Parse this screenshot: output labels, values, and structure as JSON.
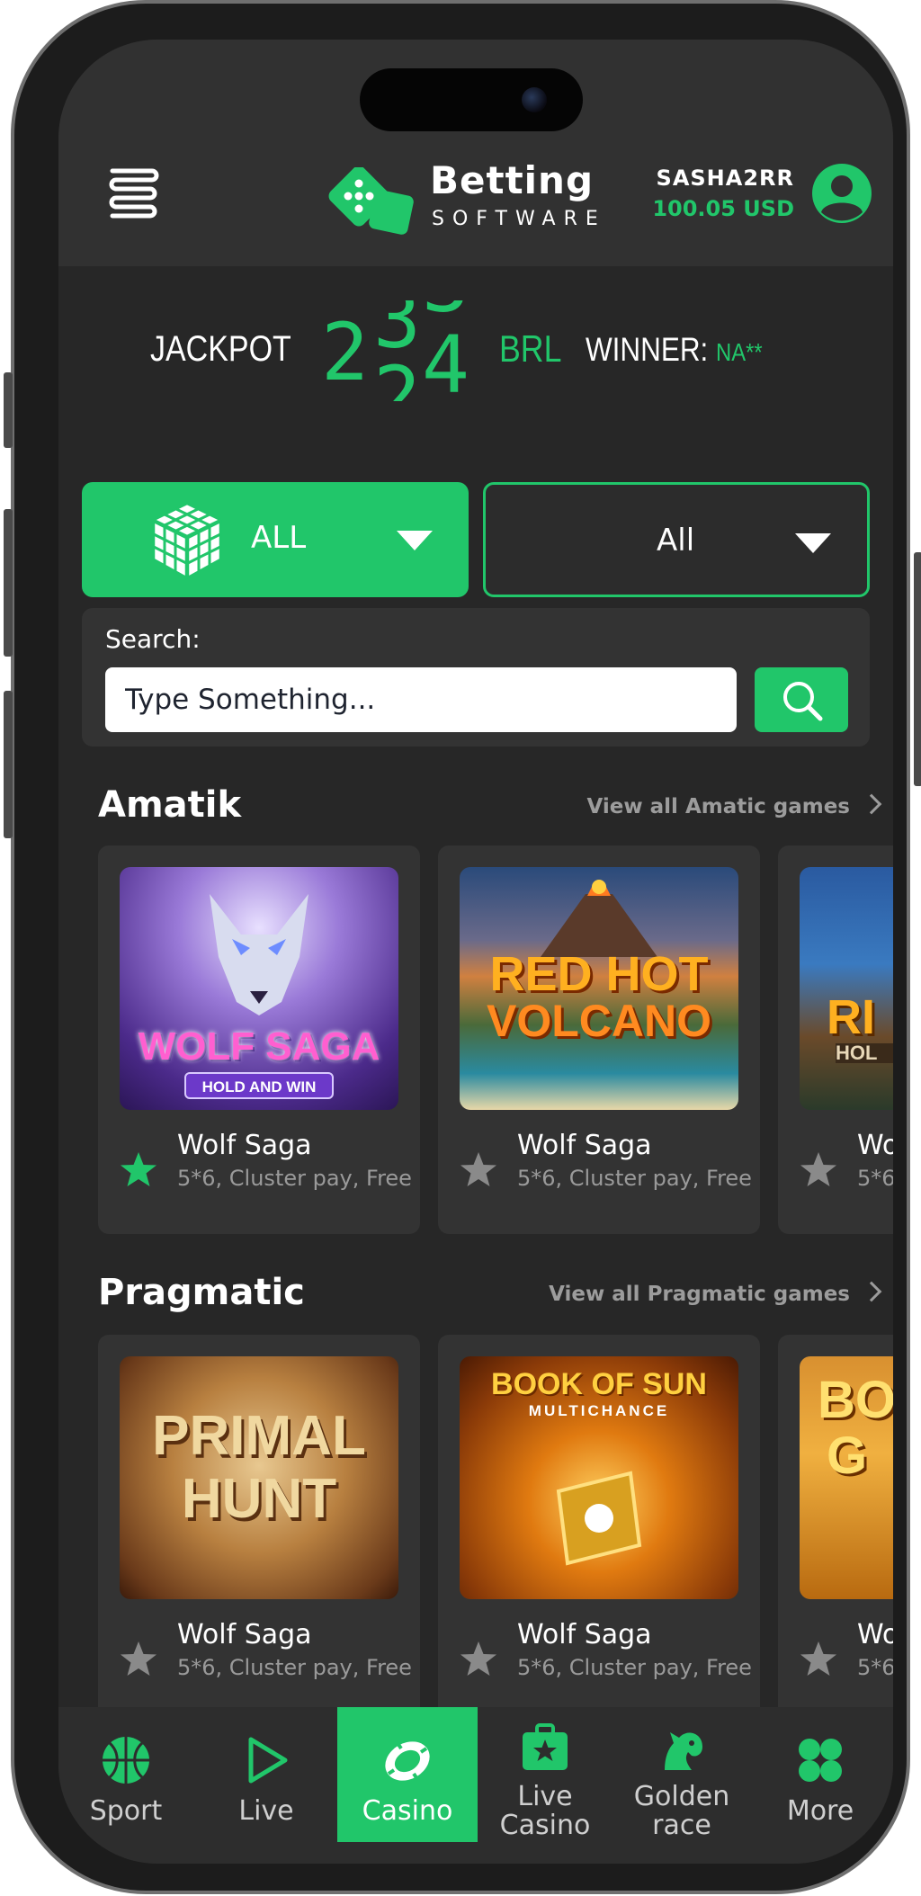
{
  "header": {
    "logo_title": "Betting",
    "logo_subtitle": "SOFTWARE",
    "username": "SASHA2RR",
    "balance": "100.05 USD"
  },
  "jackpot": {
    "label": "JACKPOT",
    "digits_visible": "2 3 4",
    "digit_1": "2",
    "digit_2_top": "3",
    "digit_2_bottom": "2",
    "digit_3_top": "3",
    "digit_3_bottom": "4",
    "currency": "BRL",
    "winner_label": "WINNER:",
    "winner_name": "NA**"
  },
  "filters": {
    "category_label": "ALL",
    "provider_label": "All"
  },
  "search": {
    "label": "Search:",
    "placeholder": "Type Something..."
  },
  "sections": [
    {
      "title": "Amatik",
      "view_all": "View all Amatic games",
      "games": [
        {
          "name": "Wolf Saga",
          "desc": "5*6, Cluster pay, Free",
          "favorite": true,
          "art_line1": "WOLF SAGA",
          "art_line2": "HOLD AND WIN"
        },
        {
          "name": "Wolf Saga",
          "desc": "5*6, Cluster pay, Free",
          "favorite": false,
          "art_line1": "RED HOT",
          "art_line2": "VOLCANO"
        },
        {
          "name": "Wo",
          "desc": "5*6,",
          "favorite": false,
          "art_line1": "RI",
          "art_line2": "HOL"
        }
      ]
    },
    {
      "title": "Pragmatic",
      "view_all": "View all Pragmatic games",
      "games": [
        {
          "name": "Wolf Saga",
          "desc": "5*6, Cluster pay, Free",
          "favorite": false,
          "art_line1": "PRIMAL",
          "art_line2": "HUNT"
        },
        {
          "name": "Wolf Saga",
          "desc": "5*6, Cluster pay, Free",
          "favorite": false,
          "art_line1": "BOOK OF SUN",
          "art_line2": "MULTICHANCE"
        },
        {
          "name": "Wo",
          "desc": "5*6,",
          "favorite": false,
          "art_line1": "BO",
          "art_line2": "G"
        }
      ]
    }
  ],
  "nav": [
    {
      "label": "Sport",
      "icon": "basketball-icon",
      "active": false
    },
    {
      "label": "Live",
      "icon": "play-icon",
      "active": false
    },
    {
      "label": "Casino",
      "icon": "casino-chip-icon",
      "active": true
    },
    {
      "label": "Live Casino",
      "line1": "Live",
      "line2": "Casino",
      "icon": "briefcase-star-icon",
      "active": false
    },
    {
      "label": "Golden race",
      "line1": "Golden",
      "line2": "race",
      "icon": "horse-icon",
      "active": false
    },
    {
      "label": "More",
      "icon": "grid-clover-icon",
      "active": false
    }
  ],
  "colors": {
    "accent": "#21c66a",
    "background": "#272727",
    "header": "#313131",
    "card": "#333333"
  }
}
